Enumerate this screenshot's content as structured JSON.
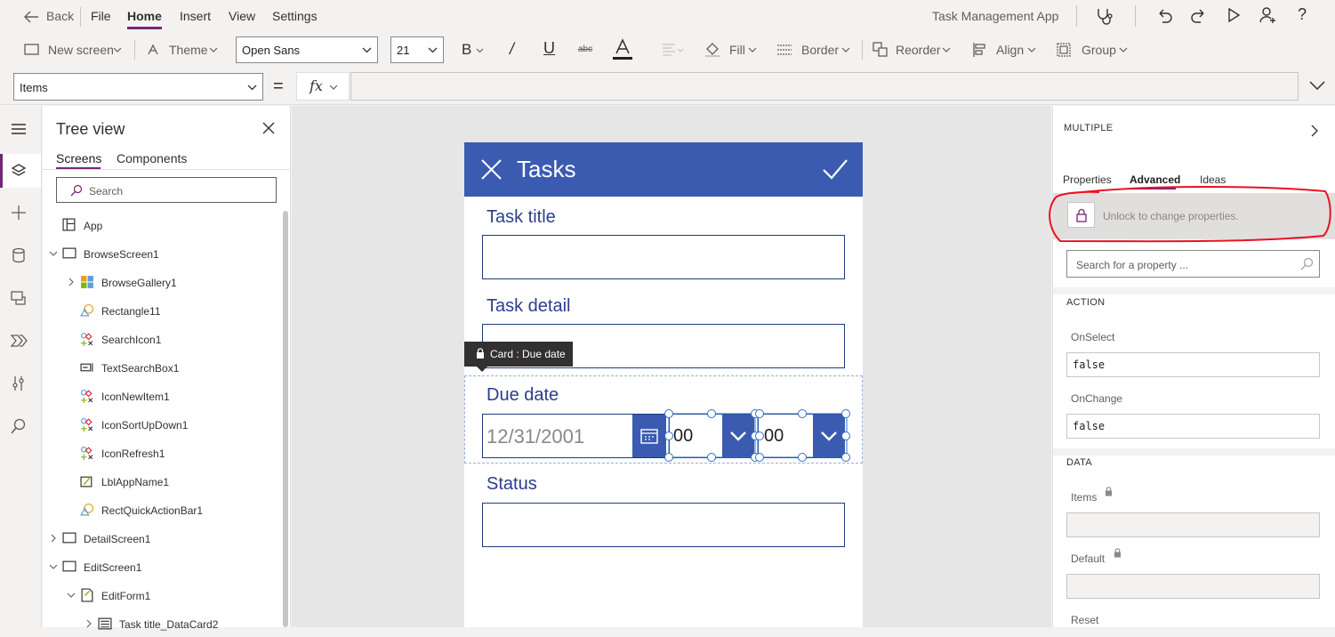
{
  "menu": {
    "back": "Back",
    "items": [
      "File",
      "Home",
      "Insert",
      "View",
      "Settings"
    ],
    "app_title": "Task Management App"
  },
  "toolbar": {
    "new_screen": "New screen",
    "theme": "Theme",
    "font": "Open Sans",
    "font_size": "21",
    "fill": "Fill",
    "border": "Border",
    "reorder": "Reorder",
    "align": "Align",
    "group": "Group"
  },
  "formula": {
    "property": "Items",
    "equals": "=",
    "fx": "fx"
  },
  "tree": {
    "title": "Tree view",
    "tabs": [
      "Screens",
      "Components"
    ],
    "search_placeholder": "Search",
    "items": [
      {
        "label": "App",
        "icon": "app-icon",
        "indent": 0,
        "expander": ""
      },
      {
        "label": "BrowseScreen1",
        "icon": "screen-icon",
        "indent": 0,
        "expander": "down"
      },
      {
        "label": "BrowseGallery1",
        "icon": "gallery-icon",
        "indent": 1,
        "expander": "right"
      },
      {
        "label": "Rectangle11",
        "icon": "shape-icon",
        "indent": 1,
        "expander": ""
      },
      {
        "label": "SearchIcon1",
        "icon": "icon-control-icon",
        "indent": 1,
        "expander": ""
      },
      {
        "label": "TextSearchBox1",
        "icon": "textinput-icon",
        "indent": 1,
        "expander": ""
      },
      {
        "label": "IconNewItem1",
        "icon": "icon-control-icon",
        "indent": 1,
        "expander": ""
      },
      {
        "label": "IconSortUpDown1",
        "icon": "icon-control-icon",
        "indent": 1,
        "expander": ""
      },
      {
        "label": "IconRefresh1",
        "icon": "icon-control-icon",
        "indent": 1,
        "expander": ""
      },
      {
        "label": "LblAppName1",
        "icon": "label-icon",
        "indent": 1,
        "expander": ""
      },
      {
        "label": "RectQuickActionBar1",
        "icon": "shape-icon",
        "indent": 1,
        "expander": ""
      },
      {
        "label": "DetailScreen1",
        "icon": "screen-icon",
        "indent": 0,
        "expander": "right"
      },
      {
        "label": "EditScreen1",
        "icon": "screen-icon",
        "indent": 0,
        "expander": "down"
      },
      {
        "label": "EditForm1",
        "icon": "form-icon",
        "indent": 1,
        "expander": "down"
      },
      {
        "label": "Task title_DataCard2",
        "icon": "card-icon",
        "indent": 2,
        "expander": "right"
      }
    ]
  },
  "phone": {
    "header_title": "Tasks",
    "fields": [
      {
        "label": "Task title",
        "value": ""
      },
      {
        "label": "Task detail",
        "value": ""
      },
      {
        "label": "Due date",
        "value": ""
      },
      {
        "label": "Status",
        "value": ""
      }
    ],
    "tooltip": "Card : Due date",
    "date_value": "12/31/2001",
    "hour_value": "00",
    "minute_value": "00",
    "colors": {
      "header": "#3a5bb0",
      "field_text": "#2c3e8c",
      "accent": "#3a5bb0"
    }
  },
  "panel": {
    "header": "MULTIPLE",
    "tabs": [
      "Properties",
      "Advanced",
      "Ideas"
    ],
    "active_tab": "Advanced",
    "unlock_text": "Unlock to change properties.",
    "search_placeholder": "Search for a property ...",
    "sections": {
      "action": "ACTION",
      "data": "DATA"
    },
    "props": {
      "onselect_label": "OnSelect",
      "onselect_value": "false",
      "onchange_label": "OnChange",
      "onchange_value": "false",
      "items_label": "Items",
      "default_label": "Default",
      "reset_label": "Reset"
    }
  },
  "colors": {
    "brand": "#742774",
    "annotation": "#e81123"
  }
}
